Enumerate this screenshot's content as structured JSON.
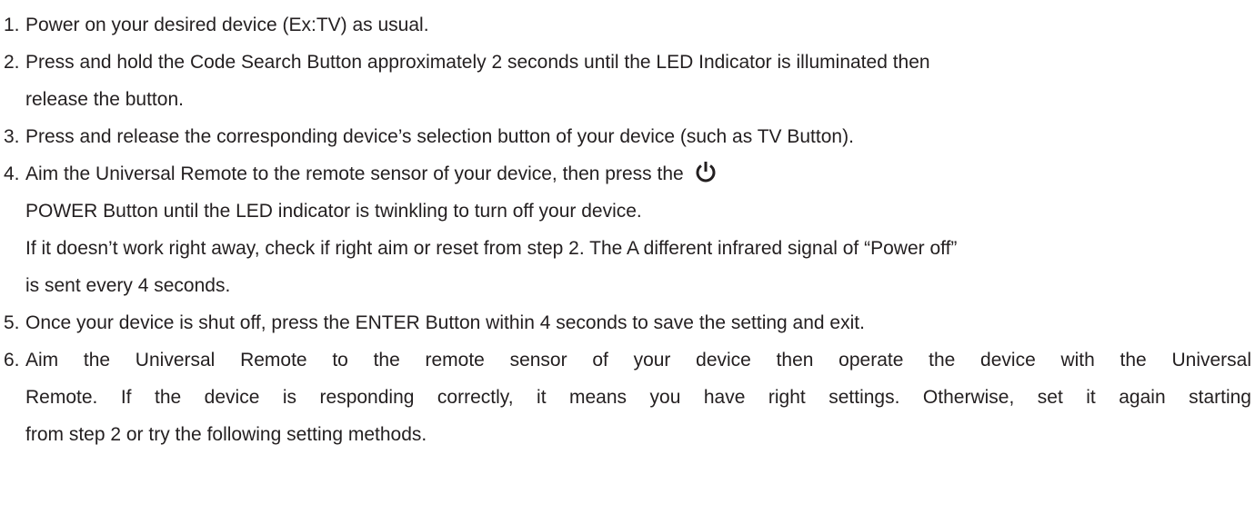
{
  "steps": [
    {
      "number": "1.",
      "lines": [
        "Power on your desired device (Ex:TV) as usual."
      ]
    },
    {
      "number": "2.",
      "lines": [
        "Press and hold the Code Search Button approximately 2 seconds until the LED Indicator is illuminated then",
        "release the button."
      ]
    },
    {
      "number": "3.",
      "lines": [
        "Press and release the corresponding device’s selection button of your device (such as TV Button)."
      ]
    },
    {
      "number": "4.",
      "lines": [
        "Aim the Universal Remote to the remote sensor of your device, then press the",
        "POWER Button until the LED indicator is twinkling to turn off your device.",
        "If it doesn’t work right away, check if right aim or reset from step 2.  The A different infrared signal of “Power off”",
        "is sent every 4 seconds."
      ],
      "icon": "power-icon"
    },
    {
      "number": "5.",
      "lines": [
        "Once your device is shut off, press the ENTER Button within 4 seconds to save the setting and exit."
      ]
    },
    {
      "number": "6.",
      "lines": [
        "Aim the Universal Remote to the remote sensor of your device then operate the device with the Universal",
        "Remote. If the device is responding correctly, it means you have right  settings. Otherwise, set it again starting",
        "from step 2 or try the following setting methods."
      ]
    }
  ]
}
